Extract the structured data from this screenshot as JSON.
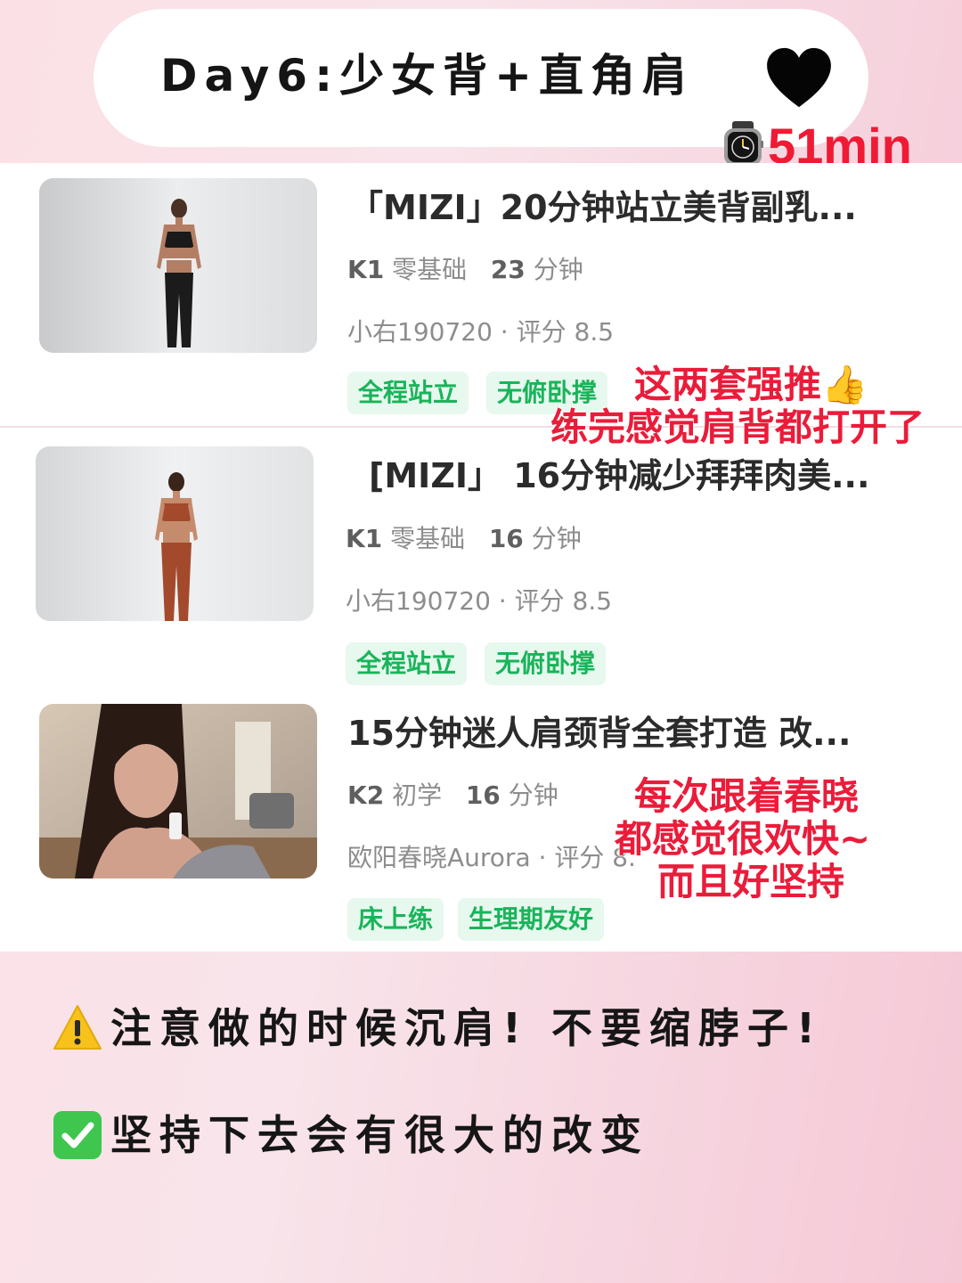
{
  "header": {
    "title": "Day6:少女背+直角肩",
    "duration": "51min"
  },
  "colors": {
    "accent_red": "#ef1b35",
    "tag_green": "#19b45a",
    "tag_bg": "#e7f8ee"
  },
  "workouts": [
    {
      "title": "「MIZI」20分钟站立美背副乳...",
      "level": "K1",
      "level_name": "零基础",
      "minutes": "23",
      "minutes_unit": "分钟",
      "author": "小右190720",
      "rating_label": "评分",
      "rating": "8.5",
      "tags": [
        "全程站立",
        "无俯卧撑"
      ],
      "thumb_icon": "workout-thumbnail-black-outfit"
    },
    {
      "title": "[MIZI」 16分钟减少拜拜肉美...",
      "level": "K1",
      "level_name": "零基础",
      "minutes": "16",
      "minutes_unit": "分钟",
      "author": "小右190720",
      "rating_label": "评分",
      "rating": "8.5",
      "tags": [
        "全程站立",
        "无俯卧撑"
      ],
      "thumb_icon": "workout-thumbnail-brown-outfit"
    },
    {
      "title": "15分钟迷人肩颈背全套打造 改...",
      "level": "K2",
      "level_name": "初学",
      "minutes": "16",
      "minutes_unit": "分钟",
      "author": "欧阳春晓Aurora",
      "rating_label": "评分",
      "rating": "8.",
      "tags": [
        "床上练",
        "生理期友好"
      ],
      "thumb_icon": "workout-thumbnail-portrait"
    }
  ],
  "annotations": {
    "first_line1": "这两套强推👍",
    "first_line2": "练完感觉肩背都打开了",
    "second_line1": "每次跟着春晓",
    "second_line2": "都感觉很欢快~",
    "second_line3": "而且好坚持"
  },
  "notes": [
    {
      "icon": "warning-icon",
      "text": "注意做的时候沉肩! 不要缩脖子!"
    },
    {
      "icon": "check-box-icon",
      "text": "坚持下去会有很大的改变"
    }
  ]
}
